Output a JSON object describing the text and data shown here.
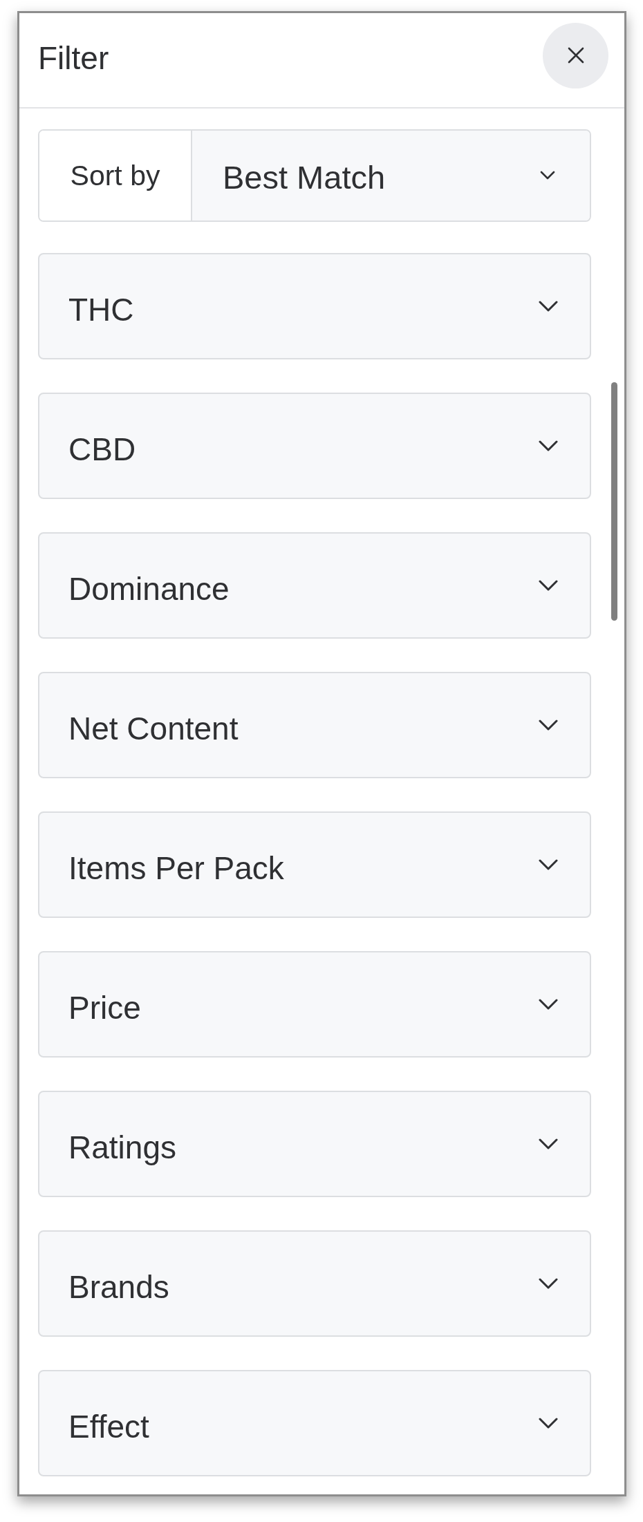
{
  "panel": {
    "title": "Filter"
  },
  "sort": {
    "label": "Sort by",
    "value": "Best Match"
  },
  "filters": [
    {
      "label": "THC",
      "expanded": false
    },
    {
      "label": "CBD",
      "expanded": false
    },
    {
      "label": "Dominance",
      "expanded": false
    },
    {
      "label": "Net Content",
      "expanded": false
    },
    {
      "label": "Items Per Pack",
      "expanded": false
    },
    {
      "label": "Price",
      "expanded": false
    },
    {
      "label": "Ratings",
      "expanded": false
    },
    {
      "label": "Brands",
      "expanded": false
    },
    {
      "label": "Effect",
      "expanded": false
    }
  ]
}
